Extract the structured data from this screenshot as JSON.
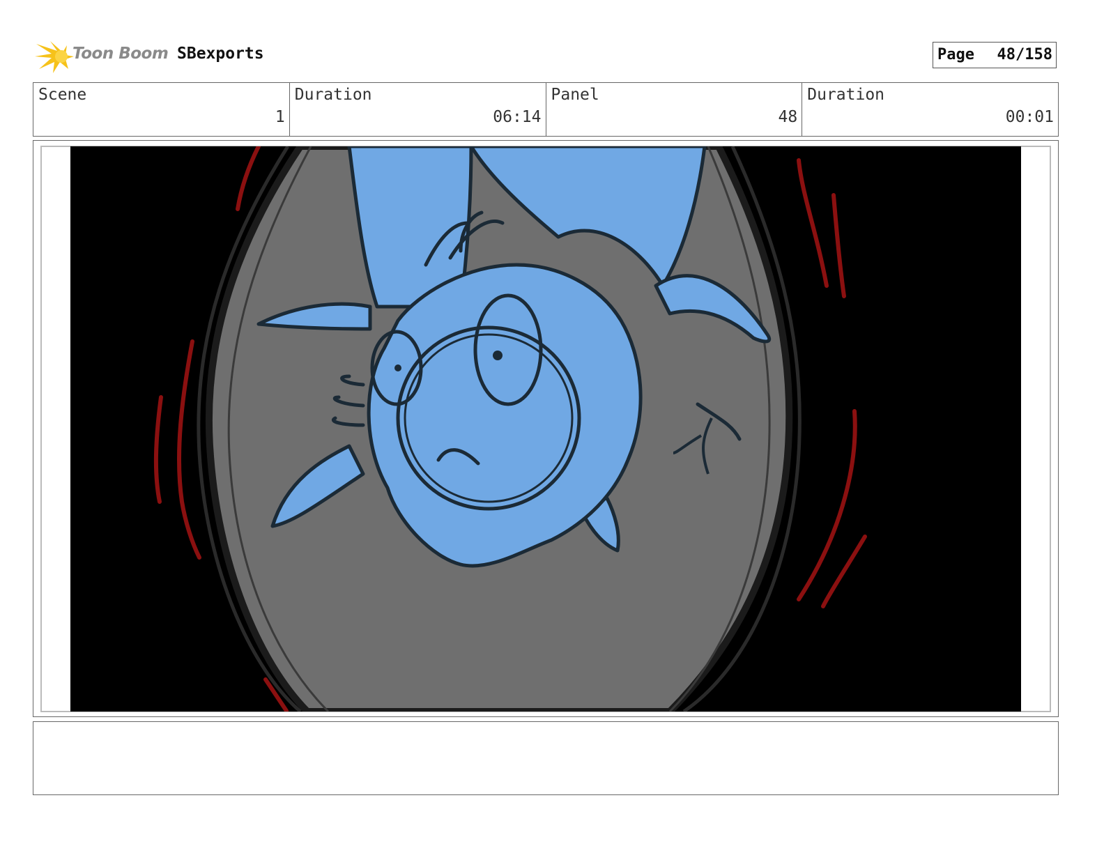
{
  "header": {
    "logo_text": "Toon Boom",
    "project_title": "SBexports",
    "page_label": "Page",
    "page_value": "48/158"
  },
  "info": {
    "scene_label": "Scene",
    "scene_value": "1",
    "scene_duration_label": "Duration",
    "scene_duration_value": "06:14",
    "panel_label": "Panel",
    "panel_value": "48",
    "panel_duration_label": "Duration",
    "panel_duration_value": "00:01"
  },
  "colors": {
    "background": "#000000",
    "vignette": "#6f6f6f",
    "character": "#70a8e4",
    "line": "#1b2a36",
    "motion_lines": "#8b1010",
    "logo_flash": "#f6c21a"
  }
}
